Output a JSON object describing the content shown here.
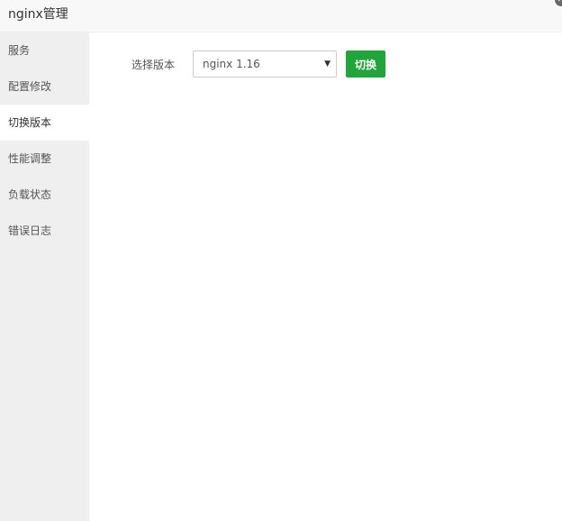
{
  "window": {
    "title": "nginx管理",
    "close_symbol": "✕"
  },
  "sidebar": {
    "items": [
      {
        "label": "服务"
      },
      {
        "label": "配置修改"
      },
      {
        "label": "切换版本"
      },
      {
        "label": "性能调整"
      },
      {
        "label": "负载状态"
      },
      {
        "label": "错误日志"
      }
    ],
    "active_index": 2
  },
  "version_switch": {
    "label": "选择版本",
    "selected_value": "nginx 1.16",
    "button_label": "切换"
  },
  "colors": {
    "accent_green": "#20a53a",
    "sidebar_bg": "#efefef",
    "titlebar_bg": "#f8f8f8"
  }
}
